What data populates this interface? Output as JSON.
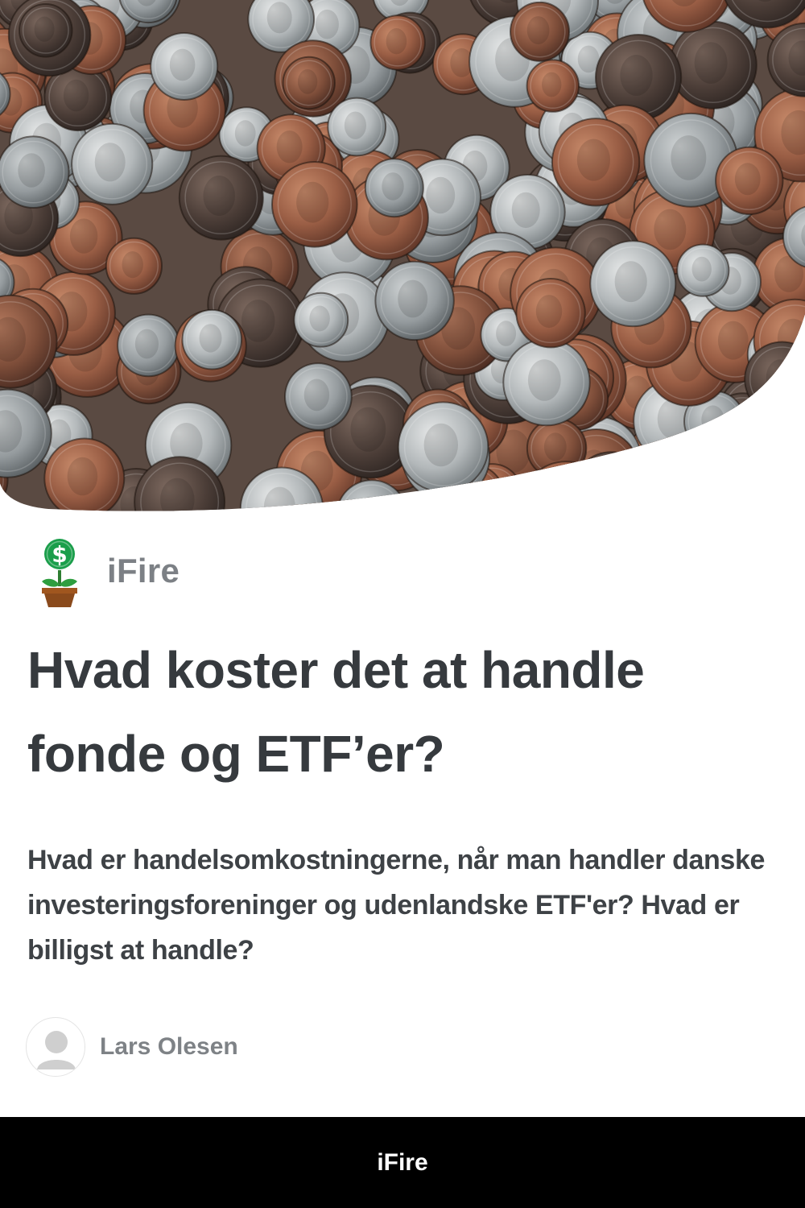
{
  "hero": {
    "image": "pile-of-coins-photo"
  },
  "brand": {
    "name": "iFire",
    "logo": "money-plant-icon"
  },
  "article": {
    "title": "Hvad koster det at handle fonde og ETF’er?",
    "subtitle": "Hvad er handelsomkostningerne, når man handler danske investeringsforeninger og udenlandske ETF'er? Hvad er billigst at handle?"
  },
  "author": {
    "name": "Lars Olesen",
    "avatar": "user-avatar-icon"
  },
  "footer": {
    "label": "iFire"
  },
  "colors": {
    "plant_green": "#1b9e4b",
    "pot_brown": "#8a4a1c",
    "footer_bg": "#000000"
  }
}
